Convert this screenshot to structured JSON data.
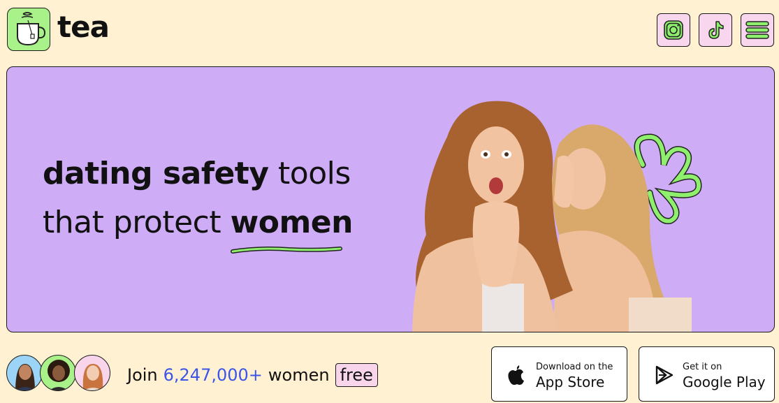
{
  "brand": {
    "name": "tea"
  },
  "header": {
    "icons": [
      "instagram-icon",
      "tiktok-icon",
      "menu-icon"
    ]
  },
  "hero": {
    "line1_bold": "dating safety",
    "line1_rest": "tools",
    "line2_rest": "that protect",
    "line2_bold": "women"
  },
  "join": {
    "prefix": "Join",
    "count": "6,247,000+",
    "suffix": "women",
    "badge": "free"
  },
  "app_store": {
    "small": "Download on the",
    "big": "App Store"
  },
  "google_play": {
    "small": "Get it on",
    "big": "Google Play"
  },
  "colors": {
    "background": "#fff1d2",
    "hero": "#cfacf6",
    "logo_bg": "#a9f28a",
    "icon_bg": "#f8d6ee",
    "accent_number": "#3b55e8",
    "squiggle": "#8ff06e"
  }
}
